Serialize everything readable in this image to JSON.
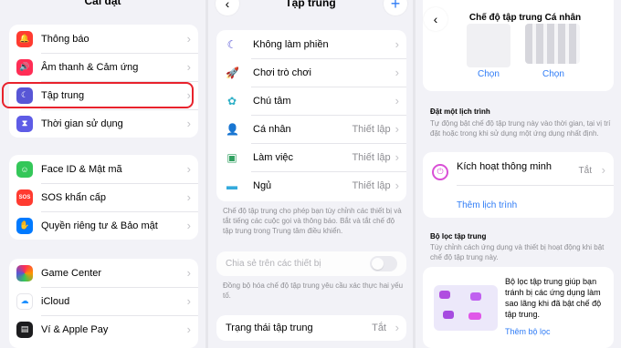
{
  "settings": {
    "title": "Cài đặt",
    "group1": [
      {
        "label": "Thông báo",
        "icon": "bell-icon",
        "color": "#ff3b30",
        "glyph": "🔔"
      },
      {
        "label": "Âm thanh & Cảm ứng",
        "icon": "speaker-icon",
        "color": "#ff2d55",
        "glyph": "🔊"
      },
      {
        "label": "Tập trung",
        "icon": "moon-icon",
        "color": "#5856d6",
        "glyph": "☾"
      },
      {
        "label": "Thời gian sử dụng",
        "icon": "hourglass-icon",
        "color": "#5e5ce6",
        "glyph": "⧗"
      }
    ],
    "group2": [
      {
        "label": "Face ID & Mật mã",
        "icon": "face-id-icon",
        "color": "#34c759",
        "glyph": "☺"
      },
      {
        "label": "SOS khẩn cấp",
        "icon": "sos-icon",
        "color": "#ff3b30",
        "glyph": "SOS"
      },
      {
        "label": "Quyền riêng tư & Bảo mật",
        "icon": "hand-icon",
        "color": "#007aff",
        "glyph": "✋"
      }
    ],
    "group3": [
      {
        "label": "Game Center",
        "icon": "game-center-icon",
        "color": "#ff9500",
        "glyph": "●"
      },
      {
        "label": "iCloud",
        "icon": "cloud-icon",
        "color": "#1e90ff",
        "glyph": "☁"
      },
      {
        "label": "Ví & Apple Pay",
        "icon": "wallet-icon",
        "color": "#1c1c1e",
        "glyph": "▤"
      }
    ]
  },
  "focus": {
    "title": "Tập trung",
    "back_glyph": "‹",
    "add_glyph": "+",
    "modes": [
      {
        "label": "Không làm phiền",
        "glyph": "☾",
        "color": "#5856d6",
        "value": ""
      },
      {
        "label": "Chơi trò chơi",
        "glyph": "🚀",
        "color": "#007aff",
        "value": ""
      },
      {
        "label": "Chú tâm",
        "glyph": "✿",
        "color": "#30b0c7",
        "value": ""
      },
      {
        "label": "Cá nhân",
        "glyph": "👤",
        "color": "#af52de",
        "value": "Thiết lập"
      },
      {
        "label": "Làm việc",
        "glyph": "▣",
        "color": "#30a060",
        "value": "Thiết lập"
      },
      {
        "label": "Ngủ",
        "glyph": "▬",
        "color": "#34aadc",
        "value": "Thiết lập"
      }
    ],
    "modes_note": "Chế độ tập trung cho phép bạn tùy chỉnh các thiết bị và tắt tiếng các cuộc gọi và thông báo. Bắt và tắt chế độ tập trung trong Trung tâm điều khiển.",
    "share_label": "Chia sẻ trên các thiết bị",
    "share_note": "Đồng bộ hóa chế độ tập trung yêu cầu xác thực hai yếu tố.",
    "status_label": "Trạng thái tập trung",
    "status_value": "Tắt"
  },
  "personal": {
    "title": "Chế độ tập trung Cá nhân",
    "back_glyph": "‹",
    "choose_left": "Chọn",
    "choose_right": "Chọn",
    "schedule_title": "Đặt một lịch trình",
    "schedule_desc": "Tự động bật chế độ tập trung này vào thời gian, tại vị trí đặt hoặc trong khi sử dụng một ứng dụng nhất định.",
    "smart_label": "Kích hoạt thông minh",
    "smart_value": "Tắt",
    "add_schedule": "Thêm lịch trình",
    "filter_title": "Bộ lọc tập trung",
    "filter_desc": "Tùy chỉnh cách ứng dụng và thiết bị hoạt động khi bật chế độ tập trung này.",
    "filter_card_text": "Bộ lọc tập trung giúp bạn tránh bị các ứng dụng làm sao lãng khi đã bật chế độ tập trung.",
    "add_filter": "Thêm bộ lọc",
    "accent": "#2f7cf6"
  }
}
